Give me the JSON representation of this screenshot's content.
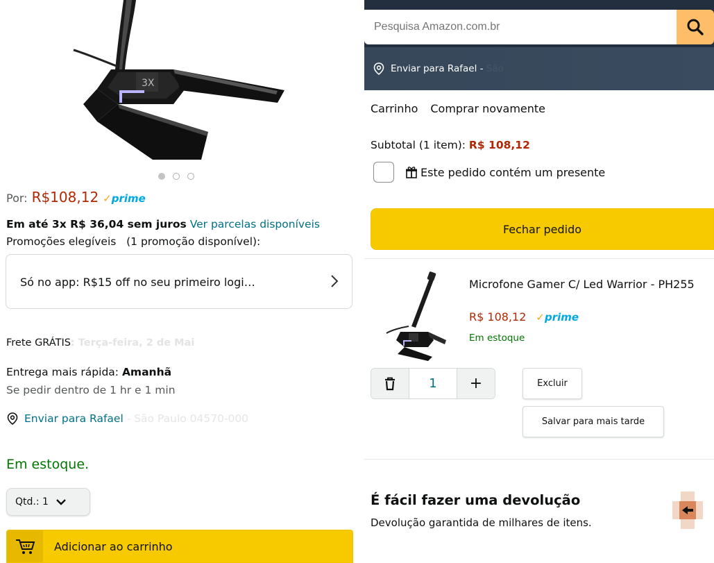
{
  "colors": {
    "price_red": "#b12704",
    "link_teal": "#007185",
    "stock_green": "#007600",
    "button_yellow": "#f7ca00",
    "header_navy": "#232f3e",
    "search_orange": "#febd69",
    "prime_blue": "#00a8e1"
  },
  "product_page": {
    "image_dots_count": 3,
    "active_dot": 0,
    "price_prefix": "Por:",
    "price": "R$108,12",
    "prime_check": "✓",
    "prime_label": "prime",
    "installments_bold": "Em até 3x R$ 36,04 sem juros",
    "installments_link": "Ver parcelas disponíveis",
    "promotions": "Promoções elegíveis   (1 promoção disponível):",
    "promo_card_text": "Só no app: R$15 off no seu primeiro logi…",
    "promo_chevron_icon": "chevron-right-icon",
    "frete_label": "Frete GRÁTIS",
    "frete_faded": ": Terça-feira, 2 de Mai",
    "entrega_label": "Entrega mais rápida: ",
    "entrega_bold": "Amanhã",
    "se_pedir": "Se pedir dentro de 1 hr e 1 min",
    "location_icon": "location-pin-icon",
    "enviar_text": "Enviar para Rafael",
    "enviar_faded": "- São Paulo 04570-000",
    "in_stock": "Em estoque.",
    "qty_label": "Qtd.: 1",
    "qty_chevron_icon": "chevron-down-icon",
    "cart_icon": "shopping-cart-icon",
    "add_to_cart": "Adicionar ao carrinho"
  },
  "cart_page": {
    "search_placeholder": "Pesquisa Amazon.com.br",
    "search_icon": "search-icon",
    "deliver_text": "Enviar para Rafael -",
    "deliver_faded": " São",
    "nav": [
      "Carrinho",
      "Comprar novamente"
    ],
    "subtotal_label": "Subtotal (1 item): ",
    "subtotal_amount": "R$ 108,12",
    "gift_icon": "gift-icon",
    "gift_text": "Este pedido contém um presente",
    "checkout": "Fechar pedido",
    "item": {
      "title": "Microfone Gamer C/ Led Warrior - PH255",
      "price": "R$ 108,12",
      "prime_check": "✓",
      "prime_label": "prime",
      "stock": "Em estoque",
      "quantity": "1"
    },
    "trash_icon": "trash-icon",
    "plus": "+",
    "delete": "Excluir",
    "save_later": "Salvar para mais tarde",
    "return_title": "É fácil fazer uma devolução",
    "return_sub": "Devolução garantida de milhares de itens.",
    "return_icon": "return-arrow-icon"
  }
}
